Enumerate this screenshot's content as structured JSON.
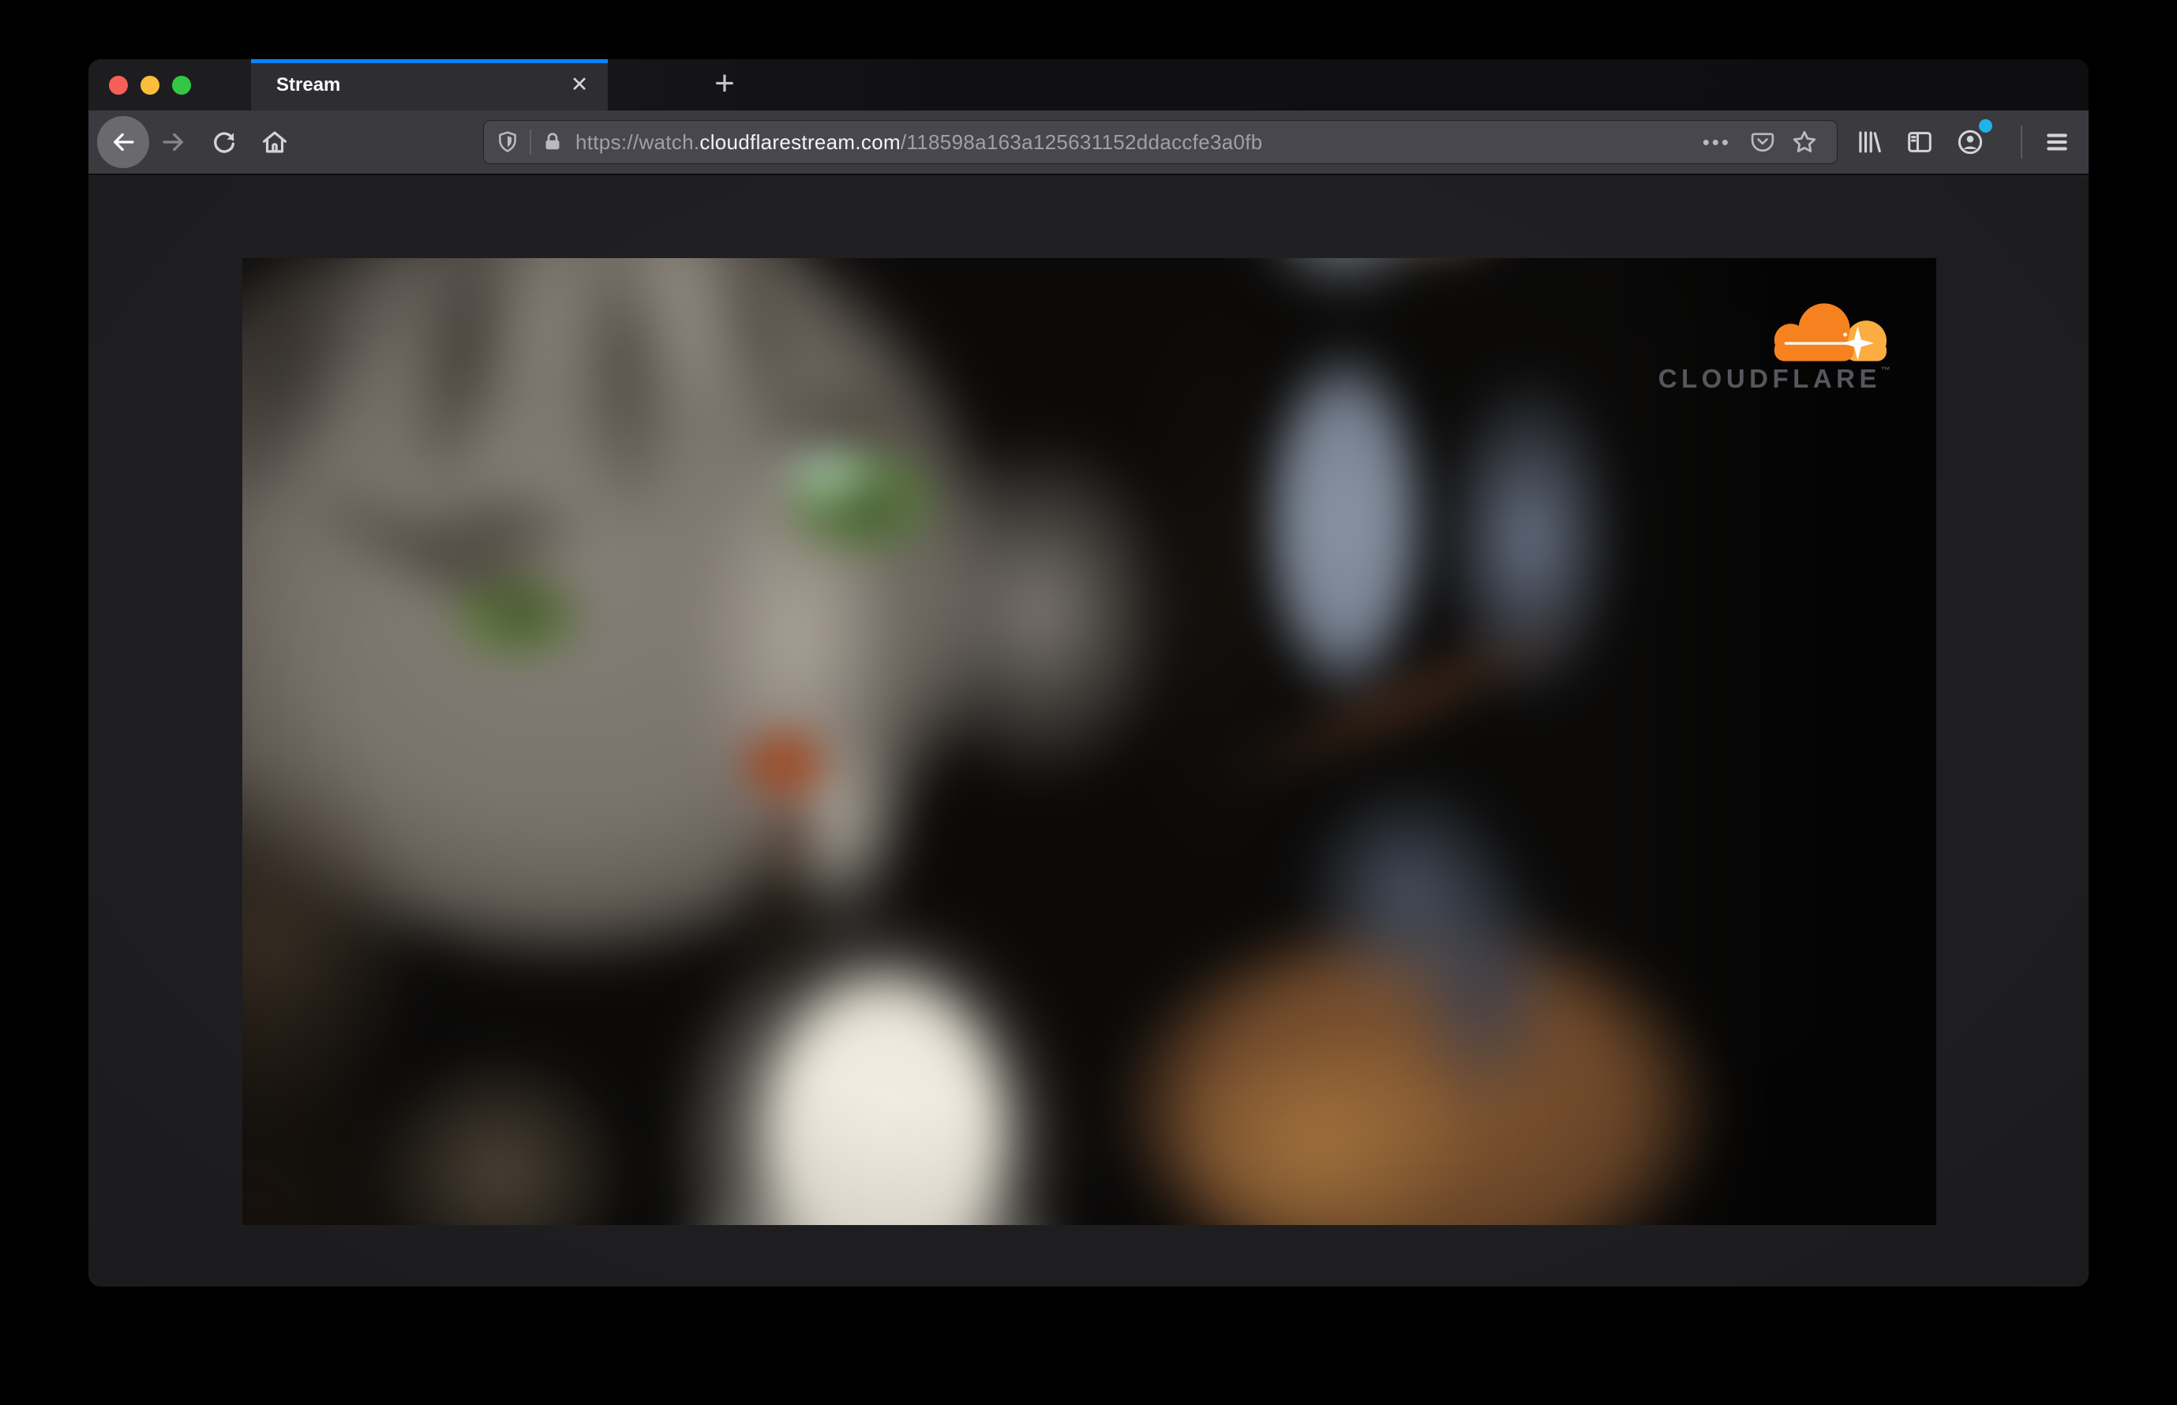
{
  "window": {
    "tab": {
      "title": "Stream",
      "close_glyph": "✕",
      "new_tab_glyph": "+"
    },
    "navbar": {
      "url": {
        "scheme_prefix": "https://watch.",
        "domain": "cloudflarestream.com",
        "path": "/118598a163a125631152ddaccfe3a0fb"
      },
      "page_actions_glyph": "•••"
    }
  },
  "video": {
    "brand": "CLOUDFLARE",
    "trademark": "™"
  },
  "colors": {
    "tab_accent": "#0a84ff",
    "toolbar": "#3a3a3f",
    "urlbar": "#47474d",
    "cloud_orange": "#f6821f",
    "cloud_amber": "#fbad41",
    "brand_text": "#55575c",
    "account_badge": "#1fb3e8",
    "traffic_red": "#f65f58",
    "traffic_yellow": "#fbbe3c",
    "traffic_green": "#32c846"
  }
}
